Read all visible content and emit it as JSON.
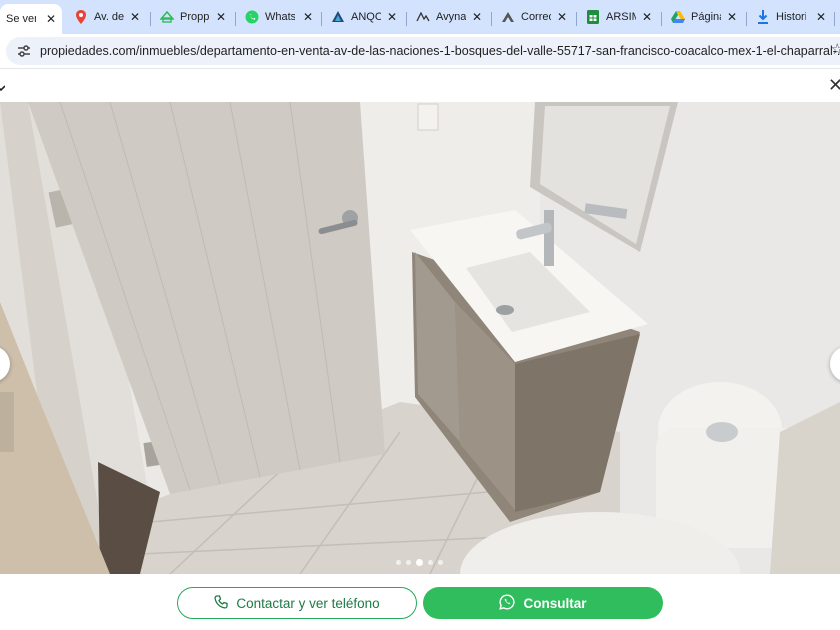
{
  "browser": {
    "tabs": [
      {
        "title": "Se ven",
        "icon": "page-icon",
        "active": true
      },
      {
        "title": "Av. de",
        "icon": "maps-pin-icon",
        "active": false
      },
      {
        "title": "Proppi",
        "icon": "proppit-icon",
        "active": false
      },
      {
        "title": "Whats",
        "icon": "whatsapp-icon",
        "active": false
      },
      {
        "title": "ANQO",
        "icon": "anqo-icon",
        "active": false
      },
      {
        "title": "Avynal",
        "icon": "avynal-icon",
        "active": false
      },
      {
        "title": "Correo",
        "icon": "mail-icon",
        "active": false
      },
      {
        "title": "ARSIM",
        "icon": "sheets-icon",
        "active": false
      },
      {
        "title": "Página",
        "icon": "drive-icon",
        "active": false
      },
      {
        "title": "Histori",
        "icon": "download-icon",
        "active": false
      }
    ],
    "close_glyph": "✕",
    "url": "propiedades.com/inmuebles/departamento-en-venta-av-de-las-naciones-1-bosques-del-valle-55717-san-francisco-coacalco-mex-1-el-chaparral-...",
    "bookmark_glyph": "☆"
  },
  "modal": {
    "close_glyph": "✕",
    "image_alt": "Baño del departamento",
    "carousel": {
      "total": 5,
      "current": 3
    }
  },
  "actions": {
    "contact_label": "Contactar y ver teléfono",
    "consult_label": "Consultar"
  },
  "colors": {
    "accent_green": "#2fbd5d",
    "outline_green": "#27a85a",
    "tabstrip": "#d3e3fd"
  }
}
